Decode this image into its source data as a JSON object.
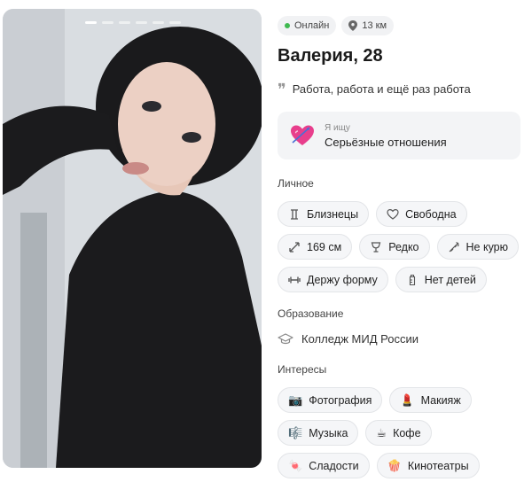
{
  "status": {
    "online": "Онлайн",
    "distance": "13 км"
  },
  "profile": {
    "name_age": "Валерия, 28",
    "bio": "Работа, работа и ещё раз работа"
  },
  "looking_for": {
    "label": "Я ищу",
    "value": "Серьёзные отношения"
  },
  "personal": {
    "title": "Личное",
    "chips": [
      {
        "label": "Близнецы",
        "icon": "gemini-icon"
      },
      {
        "label": "Свободна",
        "icon": "heart-outline-icon"
      },
      {
        "label": "169 см",
        "icon": "height-arrows-icon"
      },
      {
        "label": "Редко",
        "icon": "wine-glass-icon"
      },
      {
        "label": "Не курю",
        "icon": "no-smoking-icon"
      },
      {
        "label": "Держу форму",
        "icon": "dumbbell-icon"
      },
      {
        "label": "Нет детей",
        "icon": "baby-bottle-icon"
      }
    ]
  },
  "education": {
    "title": "Образование",
    "value": "Колледж МИД России",
    "icon": "graduation-cap-icon"
  },
  "interests": {
    "title": "Интересы",
    "chips": [
      {
        "label": "Фотография",
        "icon": "camera-icon",
        "glyph": "📷"
      },
      {
        "label": "Макияж",
        "icon": "lipstick-icon",
        "glyph": "💄"
      },
      {
        "label": "Музыка",
        "icon": "music-icon",
        "glyph": "🎼"
      },
      {
        "label": "Кофе",
        "icon": "coffee-icon",
        "glyph": "☕"
      },
      {
        "label": "Сладости",
        "icon": "candy-icon",
        "glyph": "🍬"
      },
      {
        "label": "Кинотеатры",
        "icon": "popcorn-icon",
        "glyph": "🍿"
      }
    ]
  },
  "photo": {
    "total": 6,
    "current": 1
  },
  "colors": {
    "online": "#3fb950",
    "chip_bg": "#f5f6f8",
    "accent_heart": "#e83e8c"
  }
}
